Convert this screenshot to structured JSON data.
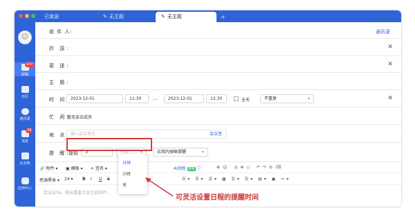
{
  "tabs": [
    {
      "label": "已发送"
    },
    {
      "label": "无主题"
    },
    {
      "label": "无主题"
    }
  ],
  "tab_add": "+",
  "sidebar": {
    "items": [
      {
        "label": "邮箱",
        "badge": "107"
      },
      {
        "label": "日历"
      },
      {
        "label": "通讯录"
      },
      {
        "label": "消息",
        "badge": "34"
      },
      {
        "label": "云文档"
      },
      {
        "label": "应用中心"
      }
    ]
  },
  "form": {
    "to_label": "收 件 人:",
    "address_book": "通讯录",
    "cc_label": "抄  送:",
    "bcc_label": "密  送:",
    "subject_label": "主  题:",
    "time_label": "时  间:",
    "start_date": "2023-12-01",
    "start_time": "11:30",
    "dash": "—",
    "end_date": "2023-12-01",
    "end_time": "12:30",
    "all_day": "全天",
    "repeat": "不重复",
    "busy_label": "忙  闲:",
    "busy_value": "暂无会议成员",
    "location_label": "地  点:",
    "location_placeholder": "输入会议地点",
    "meeting_room": "会议室",
    "remind_label": "提  醒:",
    "remind_prefix": "提前",
    "remind_value": "5",
    "remind_unit": "分钟",
    "remind_channel": "应用内弹框提醒",
    "close_glyph": "✕"
  },
  "toolbar1": {
    "attach": "附件",
    "template": "模板",
    "signature": "签名",
    "ai": "AI润色",
    "ai_badge": "限免"
  },
  "toolbar2": {
    "font": "思源黑体",
    "size": "24",
    "bold": "B",
    "italic": "I",
    "underline": "U",
    "strike": "S"
  },
  "body_placeholder": "尝试@TA，圈出重要点关注此邮件...",
  "dropdown": {
    "options": [
      "分钟",
      "小时",
      "天"
    ]
  },
  "annotation": "可灵活设置日程的提醒时间",
  "colors": {
    "brand": "#2f64d8",
    "highlight": "#d83a3a"
  }
}
